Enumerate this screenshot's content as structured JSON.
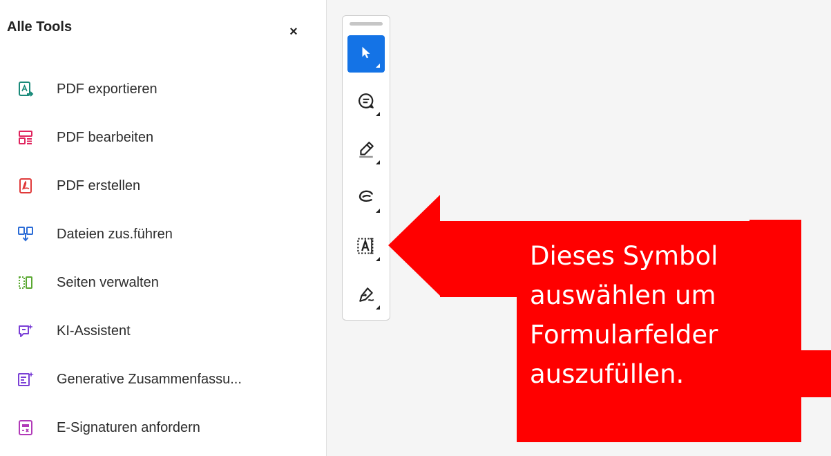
{
  "panel": {
    "title": "Alle Tools",
    "close_label": "×",
    "items": [
      {
        "label": "PDF exportieren",
        "icon": "export-pdf-icon",
        "color": "#1a8a7a"
      },
      {
        "label": "PDF bearbeiten",
        "icon": "edit-pdf-icon",
        "color": "#e0245e"
      },
      {
        "label": "PDF erstellen",
        "icon": "create-pdf-icon",
        "color": "#e03a3a"
      },
      {
        "label": "Dateien zus.führen",
        "icon": "combine-files-icon",
        "color": "#2a6bd6"
      },
      {
        "label": "Seiten verwalten",
        "icon": "organize-pages-icon",
        "color": "#5aa832"
      },
      {
        "label": "KI-Assistent",
        "icon": "ai-assistant-icon",
        "color": "#7a3fd6"
      },
      {
        "label": "Generative Zusammenfassu...",
        "icon": "generative-summary-icon",
        "color": "#7a3fd6"
      },
      {
        "label": "E-Signaturen anfordern",
        "icon": "request-esignatures-icon",
        "color": "#b13ab8"
      }
    ]
  },
  "toolbar": {
    "tools": [
      {
        "name": "select-tool",
        "icon": "cursor-icon",
        "active": true
      },
      {
        "name": "comment-tool",
        "icon": "comment-icon",
        "active": false
      },
      {
        "name": "highlight-tool",
        "icon": "highlighter-icon",
        "active": false
      },
      {
        "name": "draw-tool",
        "icon": "freehand-icon",
        "active": false
      },
      {
        "name": "fill-text-tool",
        "icon": "text-field-icon",
        "active": false
      },
      {
        "name": "sign-tool",
        "icon": "signature-icon",
        "active": false
      }
    ],
    "accent": "#1473e6"
  },
  "callout": {
    "text_lines": [
      "Dieses Symbol",
      "auswählen um",
      "Formularfelder",
      "auszufüllen."
    ],
    "color": "#ff0000"
  }
}
